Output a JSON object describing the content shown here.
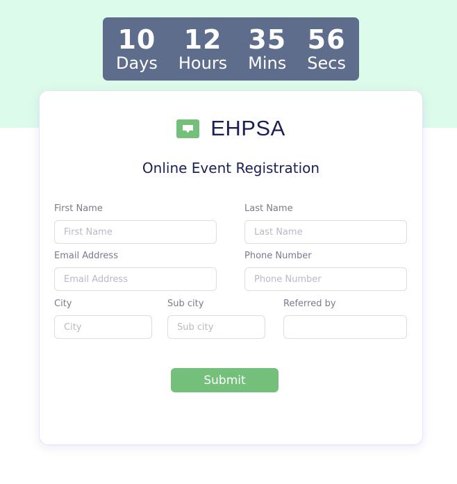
{
  "countdown": {
    "days": {
      "value": "10",
      "label": "Days"
    },
    "hours": {
      "value": "12",
      "label": "Hours"
    },
    "mins": {
      "value": "35",
      "label": "Mins"
    },
    "secs": {
      "value": "56",
      "label": "Secs"
    }
  },
  "brand": {
    "name": "EHPSA",
    "icon": "message-icon",
    "icon_color": "#74c07a"
  },
  "form": {
    "title": "Online Event Registration",
    "first_name": {
      "label": "First Name",
      "placeholder": "First Name",
      "value": ""
    },
    "last_name": {
      "label": "Last Name",
      "placeholder": "Last Name",
      "value": ""
    },
    "email": {
      "label": "Email Address",
      "placeholder": "Email Address",
      "value": ""
    },
    "phone": {
      "label": "Phone Number",
      "placeholder": "Phone Number",
      "value": ""
    },
    "city": {
      "label": "City",
      "placeholder": "City",
      "value": ""
    },
    "sub_city": {
      "label": "Sub city",
      "placeholder": "Sub city",
      "value": ""
    },
    "referred_by": {
      "label": "Referred by",
      "placeholder": "",
      "value": ""
    },
    "submit_label": "Submit"
  },
  "colors": {
    "accent": "#74c07a",
    "countdown_bg": "#5f6d8c",
    "band": "#dcfbea",
    "heading": "#1a1f55"
  }
}
